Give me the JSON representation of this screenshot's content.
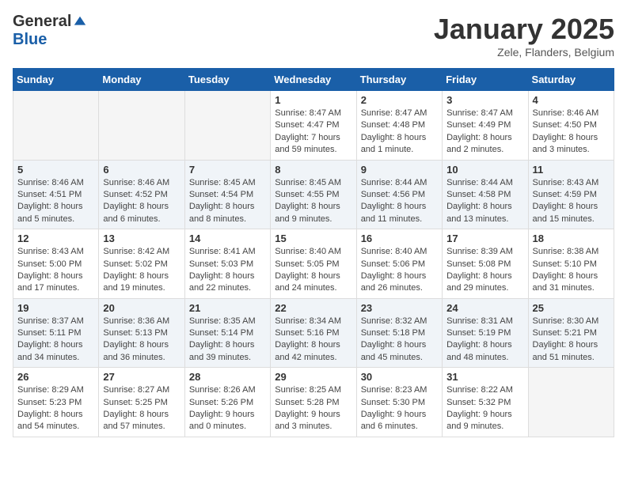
{
  "header": {
    "logo_general": "General",
    "logo_blue": "Blue",
    "month_title": "January 2025",
    "location": "Zele, Flanders, Belgium"
  },
  "days_of_week": [
    "Sunday",
    "Monday",
    "Tuesday",
    "Wednesday",
    "Thursday",
    "Friday",
    "Saturday"
  ],
  "weeks": [
    {
      "shaded": false,
      "days": [
        {
          "num": "",
          "detail": "",
          "empty": true
        },
        {
          "num": "",
          "detail": "",
          "empty": true
        },
        {
          "num": "",
          "detail": "",
          "empty": true
        },
        {
          "num": "1",
          "detail": "Sunrise: 8:47 AM\nSunset: 4:47 PM\nDaylight: 7 hours\nand 59 minutes.",
          "empty": false
        },
        {
          "num": "2",
          "detail": "Sunrise: 8:47 AM\nSunset: 4:48 PM\nDaylight: 8 hours\nand 1 minute.",
          "empty": false
        },
        {
          "num": "3",
          "detail": "Sunrise: 8:47 AM\nSunset: 4:49 PM\nDaylight: 8 hours\nand 2 minutes.",
          "empty": false
        },
        {
          "num": "4",
          "detail": "Sunrise: 8:46 AM\nSunset: 4:50 PM\nDaylight: 8 hours\nand 3 minutes.",
          "empty": false
        }
      ]
    },
    {
      "shaded": true,
      "days": [
        {
          "num": "5",
          "detail": "Sunrise: 8:46 AM\nSunset: 4:51 PM\nDaylight: 8 hours\nand 5 minutes.",
          "empty": false
        },
        {
          "num": "6",
          "detail": "Sunrise: 8:46 AM\nSunset: 4:52 PM\nDaylight: 8 hours\nand 6 minutes.",
          "empty": false
        },
        {
          "num": "7",
          "detail": "Sunrise: 8:45 AM\nSunset: 4:54 PM\nDaylight: 8 hours\nand 8 minutes.",
          "empty": false
        },
        {
          "num": "8",
          "detail": "Sunrise: 8:45 AM\nSunset: 4:55 PM\nDaylight: 8 hours\nand 9 minutes.",
          "empty": false
        },
        {
          "num": "9",
          "detail": "Sunrise: 8:44 AM\nSunset: 4:56 PM\nDaylight: 8 hours\nand 11 minutes.",
          "empty": false
        },
        {
          "num": "10",
          "detail": "Sunrise: 8:44 AM\nSunset: 4:58 PM\nDaylight: 8 hours\nand 13 minutes.",
          "empty": false
        },
        {
          "num": "11",
          "detail": "Sunrise: 8:43 AM\nSunset: 4:59 PM\nDaylight: 8 hours\nand 15 minutes.",
          "empty": false
        }
      ]
    },
    {
      "shaded": false,
      "days": [
        {
          "num": "12",
          "detail": "Sunrise: 8:43 AM\nSunset: 5:00 PM\nDaylight: 8 hours\nand 17 minutes.",
          "empty": false
        },
        {
          "num": "13",
          "detail": "Sunrise: 8:42 AM\nSunset: 5:02 PM\nDaylight: 8 hours\nand 19 minutes.",
          "empty": false
        },
        {
          "num": "14",
          "detail": "Sunrise: 8:41 AM\nSunset: 5:03 PM\nDaylight: 8 hours\nand 22 minutes.",
          "empty": false
        },
        {
          "num": "15",
          "detail": "Sunrise: 8:40 AM\nSunset: 5:05 PM\nDaylight: 8 hours\nand 24 minutes.",
          "empty": false
        },
        {
          "num": "16",
          "detail": "Sunrise: 8:40 AM\nSunset: 5:06 PM\nDaylight: 8 hours\nand 26 minutes.",
          "empty": false
        },
        {
          "num": "17",
          "detail": "Sunrise: 8:39 AM\nSunset: 5:08 PM\nDaylight: 8 hours\nand 29 minutes.",
          "empty": false
        },
        {
          "num": "18",
          "detail": "Sunrise: 8:38 AM\nSunset: 5:10 PM\nDaylight: 8 hours\nand 31 minutes.",
          "empty": false
        }
      ]
    },
    {
      "shaded": true,
      "days": [
        {
          "num": "19",
          "detail": "Sunrise: 8:37 AM\nSunset: 5:11 PM\nDaylight: 8 hours\nand 34 minutes.",
          "empty": false
        },
        {
          "num": "20",
          "detail": "Sunrise: 8:36 AM\nSunset: 5:13 PM\nDaylight: 8 hours\nand 36 minutes.",
          "empty": false
        },
        {
          "num": "21",
          "detail": "Sunrise: 8:35 AM\nSunset: 5:14 PM\nDaylight: 8 hours\nand 39 minutes.",
          "empty": false
        },
        {
          "num": "22",
          "detail": "Sunrise: 8:34 AM\nSunset: 5:16 PM\nDaylight: 8 hours\nand 42 minutes.",
          "empty": false
        },
        {
          "num": "23",
          "detail": "Sunrise: 8:32 AM\nSunset: 5:18 PM\nDaylight: 8 hours\nand 45 minutes.",
          "empty": false
        },
        {
          "num": "24",
          "detail": "Sunrise: 8:31 AM\nSunset: 5:19 PM\nDaylight: 8 hours\nand 48 minutes.",
          "empty": false
        },
        {
          "num": "25",
          "detail": "Sunrise: 8:30 AM\nSunset: 5:21 PM\nDaylight: 8 hours\nand 51 minutes.",
          "empty": false
        }
      ]
    },
    {
      "shaded": false,
      "days": [
        {
          "num": "26",
          "detail": "Sunrise: 8:29 AM\nSunset: 5:23 PM\nDaylight: 8 hours\nand 54 minutes.",
          "empty": false
        },
        {
          "num": "27",
          "detail": "Sunrise: 8:27 AM\nSunset: 5:25 PM\nDaylight: 8 hours\nand 57 minutes.",
          "empty": false
        },
        {
          "num": "28",
          "detail": "Sunrise: 8:26 AM\nSunset: 5:26 PM\nDaylight: 9 hours\nand 0 minutes.",
          "empty": false
        },
        {
          "num": "29",
          "detail": "Sunrise: 8:25 AM\nSunset: 5:28 PM\nDaylight: 9 hours\nand 3 minutes.",
          "empty": false
        },
        {
          "num": "30",
          "detail": "Sunrise: 8:23 AM\nSunset: 5:30 PM\nDaylight: 9 hours\nand 6 minutes.",
          "empty": false
        },
        {
          "num": "31",
          "detail": "Sunrise: 8:22 AM\nSunset: 5:32 PM\nDaylight: 9 hours\nand 9 minutes.",
          "empty": false
        },
        {
          "num": "",
          "detail": "",
          "empty": true
        }
      ]
    }
  ]
}
